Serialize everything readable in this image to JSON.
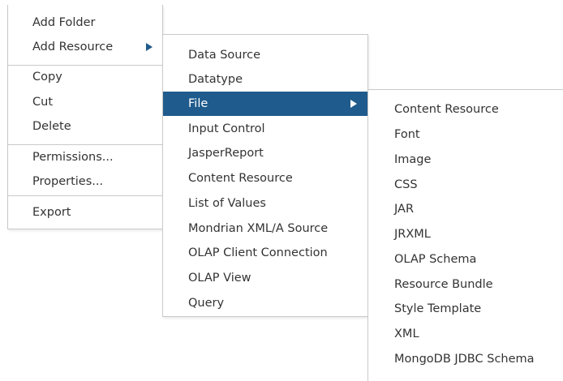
{
  "colors": {
    "highlight": "#1f5b8c",
    "highlight_text": "#ffffff",
    "separator": "#c9c9c9"
  },
  "context_menu": {
    "items": [
      {
        "label": "Add Folder"
      },
      {
        "label": "Add Resource",
        "icon": "submenu-arrow-icon"
      },
      {
        "label": "Copy"
      },
      {
        "label": "Cut"
      },
      {
        "label": "Delete"
      },
      {
        "label": "Permissions..."
      },
      {
        "label": "Properties..."
      },
      {
        "label": "Export"
      }
    ]
  },
  "add_resource_menu": {
    "items": [
      {
        "label": "Data Source"
      },
      {
        "label": "Datatype"
      },
      {
        "label": "File",
        "icon": "submenu-arrow-icon",
        "highlighted": true
      },
      {
        "label": "Input Control"
      },
      {
        "label": "JasperReport"
      },
      {
        "label": "Content Resource"
      },
      {
        "label": "List of Values"
      },
      {
        "label": "Mondrian XML/A Source"
      },
      {
        "label": "OLAP Client Connection"
      },
      {
        "label": "OLAP View"
      },
      {
        "label": "Query"
      }
    ]
  },
  "file_menu": {
    "items": [
      {
        "label": "Content Resource"
      },
      {
        "label": "Font"
      },
      {
        "label": "Image"
      },
      {
        "label": "CSS"
      },
      {
        "label": "JAR"
      },
      {
        "label": "JRXML"
      },
      {
        "label": "OLAP Schema"
      },
      {
        "label": "Resource Bundle"
      },
      {
        "label": "Style Template"
      },
      {
        "label": "XML"
      },
      {
        "label": "MongoDB JDBC Schema"
      }
    ]
  }
}
